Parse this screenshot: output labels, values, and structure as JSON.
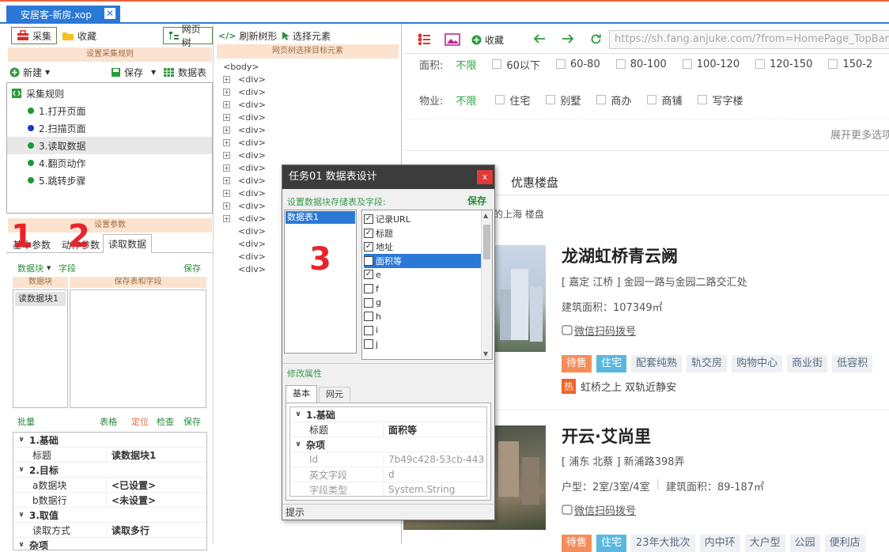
{
  "window": {
    "tab_title": "安居客-新房.xop",
    "close": "✕"
  },
  "left": {
    "toolbar": {
      "collect": "采集",
      "favorite": "收藏",
      "web_tree": "网页树"
    },
    "rule_header": "设置采集规则",
    "actions": {
      "new": "新建",
      "save": "保存",
      "datatable": "数据表"
    },
    "tree": {
      "root": "采集规则",
      "items": [
        {
          "label": "1.打开页面",
          "color": "#1a9a33"
        },
        {
          "label": "2.扫描页面",
          "color": "#1b36c9"
        },
        {
          "label": "3.读取数据",
          "color": "#1a9a33"
        },
        {
          "label": "4.翻页动作",
          "color": "#1a9a33"
        },
        {
          "label": "5.跳转步骤",
          "color": "#1a9a33"
        }
      ]
    },
    "param_header": "设置参数",
    "param_tabs": [
      "基本参数",
      "动作参数",
      "读取数据"
    ],
    "markers": [
      "1",
      "2",
      "3"
    ],
    "block_bar": {
      "block": "数据块",
      "field": "字段",
      "save": "保存"
    },
    "block_headers": {
      "left": "数据块",
      "right": "保存表和字段"
    },
    "block_items": [
      "读数据块1"
    ],
    "bottom_bar": {
      "batch": "批量",
      "table": "表格",
      "locate": "定位",
      "check": "检查",
      "save": "保存"
    },
    "props": [
      {
        "kind": "group",
        "label": "1.基础"
      },
      {
        "kind": "row",
        "key": "标题",
        "value": "读数据块1"
      },
      {
        "kind": "group",
        "label": "2.目标"
      },
      {
        "kind": "row",
        "key": "a数据块",
        "value": "<已设置>"
      },
      {
        "kind": "row",
        "key": "b数据行",
        "value": "<未设置>"
      },
      {
        "kind": "group",
        "label": "3.取值"
      },
      {
        "kind": "row",
        "key": "读取方式",
        "value": "读取多行"
      },
      {
        "kind": "group",
        "label": "杂项"
      }
    ]
  },
  "middle": {
    "refresh": "刷新树形",
    "select": "选择元素",
    "header": "网页树选择目标元素",
    "body_tag": "<body>",
    "div_tag": "<div>",
    "div_rows": [
      true,
      true,
      true,
      true,
      true,
      true,
      true,
      true,
      true,
      true,
      true,
      true,
      false,
      false,
      false,
      false
    ]
  },
  "browser": {
    "favorite": "收藏",
    "url": "https://sh.fang.anjuke.com/?from=HomePage_TopBar",
    "area_label": "面积:",
    "area_all": "不限",
    "area_opts": [
      "60以下",
      "60-80",
      "80-100",
      "100-120",
      "120-150",
      "150-2"
    ],
    "prop_label": "物业:",
    "prop_all": "不限",
    "prop_opts": [
      "住宅",
      "别墅",
      "商办",
      "商铺",
      "写字楼"
    ],
    "more": "展开更多选项",
    "tab_active": "优惠楼盘",
    "subtitle": "的上海 楼盘",
    "listings": [
      {
        "name": "龙湖虹桥青云阙",
        "addr": "[ 嘉定 江桥 ] 金园一路与金园二路交汇处",
        "info": "建筑面积：107349㎡",
        "wechat": "微信扫码拨号",
        "tags": [
          {
            "t": "待售",
            "bg": "#f58d5a",
            "fg": "#fff"
          },
          {
            "t": "住宅",
            "bg": "#59b8e0",
            "fg": "#fff"
          },
          {
            "t": "配套纯熟",
            "bg": "#eef0f3",
            "fg": "#5b6b80"
          },
          {
            "t": "轨交房",
            "bg": "#eef0f3",
            "fg": "#5b6b80"
          },
          {
            "t": "购物中心",
            "bg": "#eef0f3",
            "fg": "#5b6b80"
          },
          {
            "t": "商业街",
            "bg": "#eef0f3",
            "fg": "#5b6b80"
          },
          {
            "t": "低容积",
            "bg": "#eef0f3",
            "fg": "#5b6b80"
          }
        ],
        "hot_badge": "热",
        "hot": "虹桥之上 双轨近静安"
      },
      {
        "name": "开云·艾尚里",
        "addr": "[ 浦东 北蔡 ] 新浦路398弄",
        "info_a": "户型：2室/3室/4室",
        "info_b": "建筑面积：89-187㎡",
        "wechat": "微信扫码拨号",
        "tags": [
          {
            "t": "待售",
            "bg": "#f58d5a",
            "fg": "#fff"
          },
          {
            "t": "住宅",
            "bg": "#59b8e0",
            "fg": "#fff"
          },
          {
            "t": "23年大批次",
            "bg": "#eef0f3",
            "fg": "#5b6b80"
          },
          {
            "t": "内中环",
            "bg": "#eef0f3",
            "fg": "#5b6b80"
          },
          {
            "t": "大户型",
            "bg": "#eef0f3",
            "fg": "#5b6b80"
          },
          {
            "t": "公园",
            "bg": "#eef0f3",
            "fg": "#5b6b80"
          },
          {
            "t": "便利店",
            "bg": "#eef0f3",
            "fg": "#5b6b80"
          }
        ]
      }
    ]
  },
  "dialog": {
    "title": "任务01 数据表设计",
    "close": "x",
    "label": "设置数据块存储表及字段:",
    "save": "保存",
    "tables": [
      "数据表1"
    ],
    "fields": [
      {
        "name": "记录URL",
        "checked": true
      },
      {
        "name": "标题",
        "checked": true
      },
      {
        "name": "地址",
        "checked": true
      },
      {
        "name": "面积等",
        "checked": true,
        "selected": true
      },
      {
        "name": "e",
        "checked": true
      },
      {
        "name": "f",
        "checked": false
      },
      {
        "name": "g",
        "checked": false
      },
      {
        "name": "h",
        "checked": false
      },
      {
        "name": "i",
        "checked": false
      },
      {
        "name": "j",
        "checked": false
      }
    ],
    "modify": "修改属性",
    "tabs": [
      "基本",
      "网元"
    ],
    "props": [
      {
        "kind": "group",
        "label": "1.基础"
      },
      {
        "kind": "row",
        "key": "标题",
        "value": "面积等",
        "bold": true
      },
      {
        "kind": "group",
        "label": "杂项"
      },
      {
        "kind": "row",
        "key": "Id",
        "value": "7b49c428-53cb-443",
        "dim": true
      },
      {
        "kind": "row",
        "key": "英文字段",
        "value": "d",
        "dim": true
      },
      {
        "kind": "row",
        "key": "字段类型",
        "value": "System.String",
        "dim": true
      }
    ],
    "hint": "提示"
  }
}
